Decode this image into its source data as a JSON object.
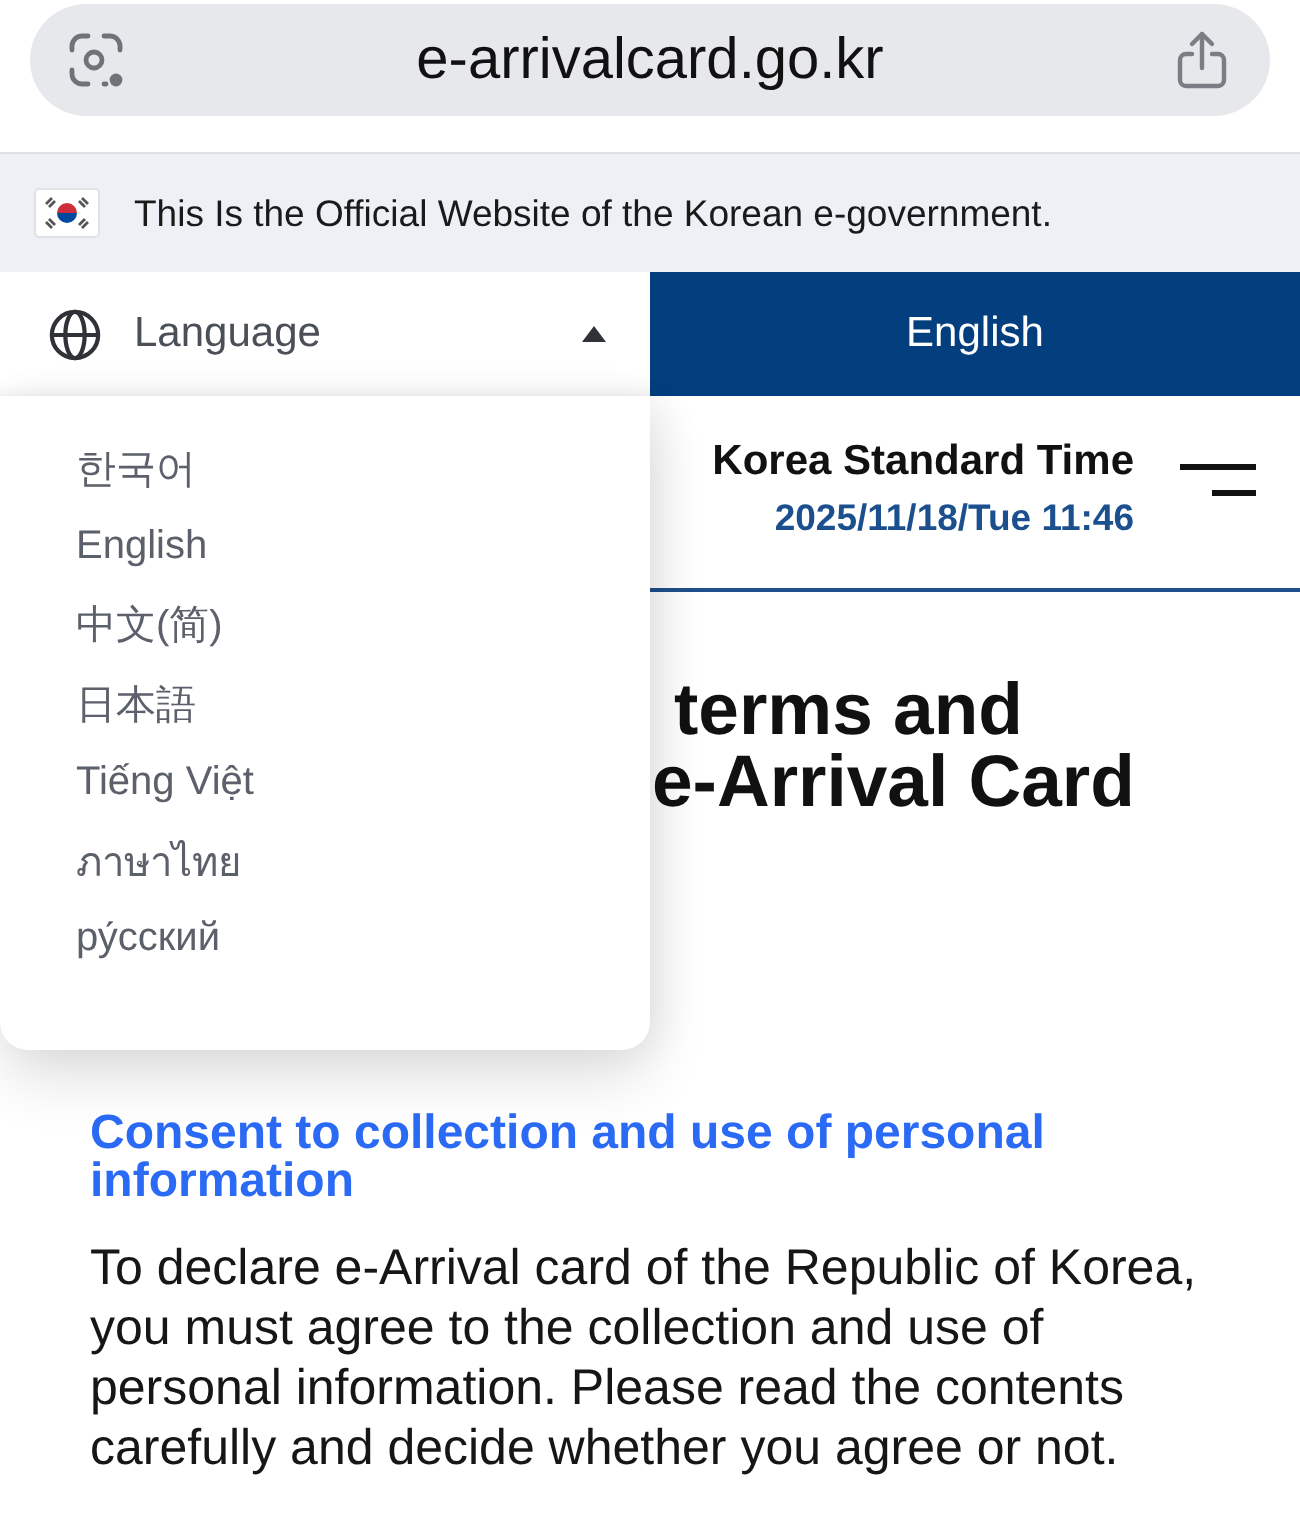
{
  "browser": {
    "url": "e-arrivalcard.go.kr"
  },
  "gov_banner": {
    "text": "This Is the Official Website of the Korean e-government."
  },
  "language_menu": {
    "label": "Language",
    "expanded": true,
    "options": [
      {
        "label": "한국어"
      },
      {
        "label": "English"
      },
      {
        "label": "中文(简)"
      },
      {
        "label": "日本語"
      },
      {
        "label": "Tiếng Việt"
      },
      {
        "label": "ภาษาไทย"
      },
      {
        "label": "ру́сский"
      }
    ]
  },
  "current_language": "English",
  "clock": {
    "label": "Korea Standard Time",
    "datetime": "2025/11/18/Tue 11:46"
  },
  "page_title_lines": [
    "terms and",
    "e-Arrival Card"
  ],
  "consent": {
    "heading": "Consent to collection and use of personal information",
    "text": "To declare e-Arrival card of the Republic of Korea, you must agree to the collection and use of personal information. Please read the contents carefully and decide whether you agree or not."
  }
}
